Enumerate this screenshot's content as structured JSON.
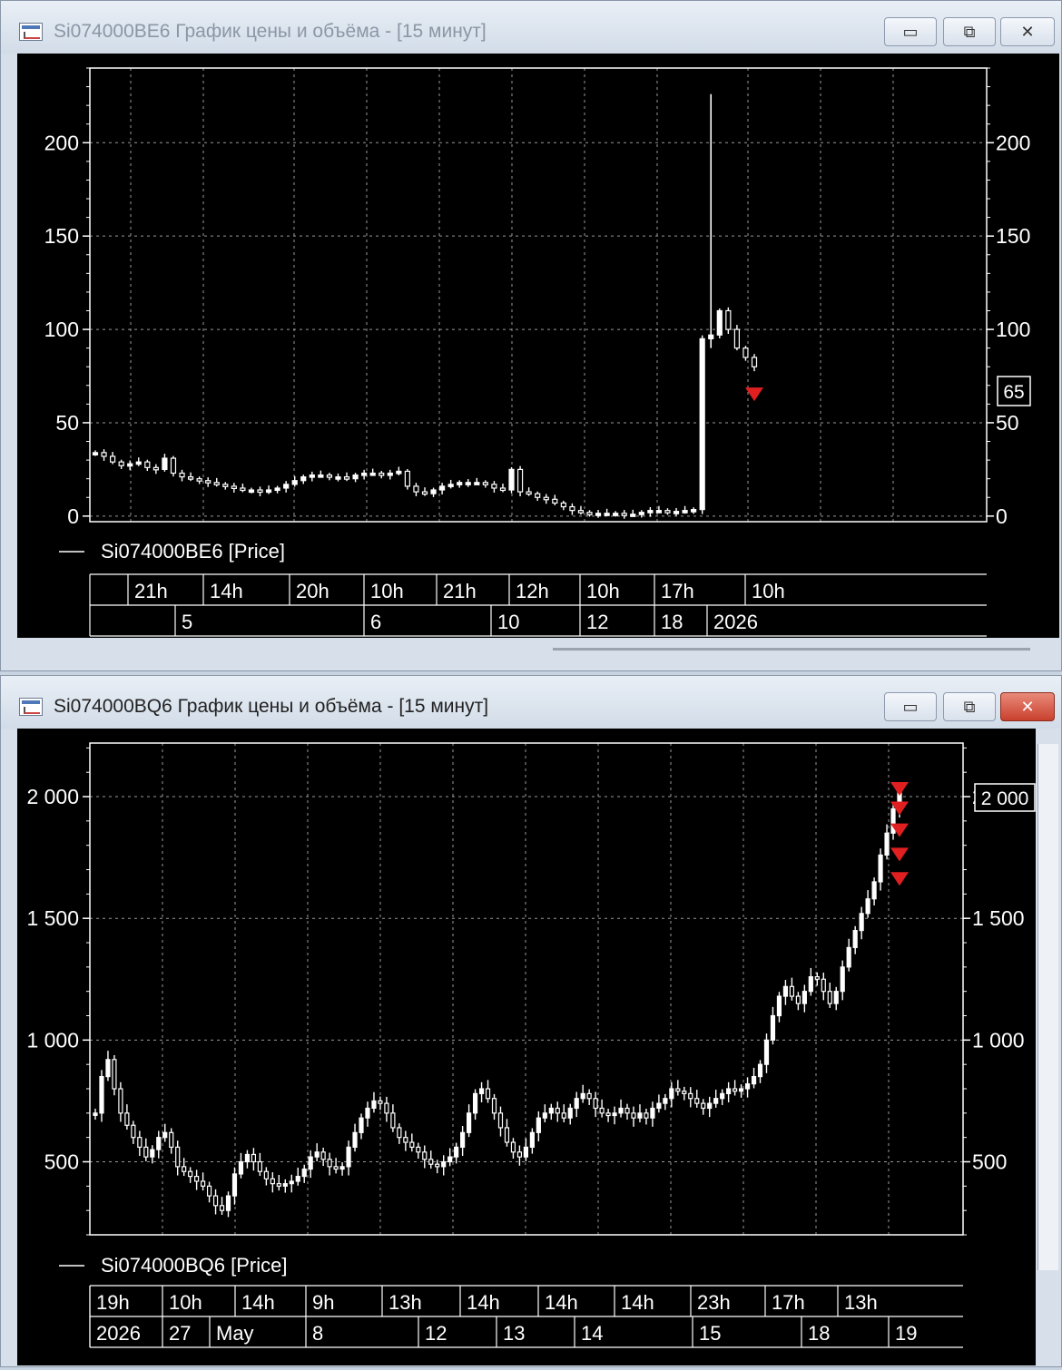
{
  "colors": {
    "background": "#000000",
    "grid": "#9a9a9a",
    "candle": "#ffffff",
    "marker": "#e02020",
    "window": "#d7e0ea",
    "close_active": "#c9402e"
  },
  "icons": {
    "app": "chart-window-icon",
    "minimize": "minimize-icon",
    "maximize": "maximize-icon",
    "close": "close-icon"
  },
  "windows": [
    {
      "title": "Si074000BE6 График цены и объёма - [15 минут]",
      "buttons": {
        "minimize": "▭",
        "maximize": "⧉",
        "close": "✕"
      },
      "legend": "Si074000BE6 [Price]",
      "price_badge": "65",
      "time_row": [
        "21h",
        "14h",
        "20h",
        "10h",
        "21h",
        "12h",
        "10h",
        "17h",
        "10h"
      ],
      "date_row": [
        "5",
        "6",
        "10",
        "12",
        "18",
        "2026"
      ]
    },
    {
      "title": "Si074000BQ6 График цены и объёма - [15 минут]",
      "buttons": {
        "minimize": "▭",
        "maximize": "⧉",
        "close": "✕"
      },
      "legend": "Si074000BQ6 [Price]",
      "price_badge": "2 000",
      "time_row": [
        "19h",
        "10h",
        "14h",
        "9h",
        "13h",
        "14h",
        "14h",
        "14h",
        "23h",
        "17h",
        "13h"
      ],
      "date_row": [
        "2026",
        "27",
        "May",
        "8",
        "12",
        "13",
        "14",
        "15",
        "18",
        "19"
      ]
    }
  ],
  "chart_data": [
    {
      "type": "candlestick",
      "title": "",
      "xlabel": "",
      "ylabel": "",
      "ylim": [
        -3,
        240
      ],
      "y_ticks": [
        0,
        50,
        100,
        150,
        200
      ],
      "y_tick_labels": [
        "0",
        "50",
        "100",
        "150",
        "200"
      ],
      "grid": true,
      "legend": "bottom-left",
      "series": [
        {
          "name": "Si074000BE6 [Price]",
          "values": [
            34,
            32,
            29,
            27,
            28,
            29,
            26,
            25,
            31,
            23,
            21,
            20,
            19,
            18,
            17,
            16,
            15,
            14,
            14,
            13,
            14,
            15,
            17,
            19,
            21,
            22,
            22,
            21,
            21,
            20,
            22,
            23,
            23,
            22,
            23,
            24,
            16,
            13,
            12,
            14,
            16,
            17,
            18,
            18,
            18,
            17,
            15,
            14,
            25,
            13,
            12,
            10,
            9,
            7,
            5,
            3,
            2,
            1.5,
            1.5,
            1.5,
            1.5,
            1,
            1,
            2,
            3,
            3,
            2.5,
            2.5,
            3,
            3.5,
            95,
            97,
            110,
            100,
            90,
            85,
            80
          ],
          "last_value": 65
        }
      ],
      "markers": [
        {
          "value": 65
        }
      ]
    },
    {
      "type": "candlestick",
      "title": "",
      "xlabel": "",
      "ylabel": "",
      "ylim": [
        200,
        2220
      ],
      "y_ticks": [
        500,
        1000,
        1500,
        2000
      ],
      "y_tick_labels": [
        "500",
        "1 000",
        "1 500",
        "2 000"
      ],
      "grid": true,
      "legend": "bottom-left",
      "series": [
        {
          "name": "Si074000BQ6 [Price]",
          "values": [
            700,
            850,
            920,
            800,
            700,
            650,
            600,
            560,
            520,
            550,
            600,
            620,
            560,
            480,
            460,
            440,
            420,
            400,
            360,
            320,
            300,
            360,
            450,
            500,
            530,
            500,
            460,
            430,
            410,
            400,
            410,
            420,
            440,
            470,
            520,
            540,
            510,
            480,
            470,
            480,
            560,
            620,
            680,
            720,
            750,
            740,
            700,
            640,
            600,
            580,
            560,
            540,
            510,
            490,
            480,
            500,
            520,
            560,
            620,
            700,
            780,
            800,
            760,
            700,
            640,
            580,
            540,
            520,
            560,
            620,
            680,
            700,
            720,
            700,
            680,
            720,
            760,
            780,
            760,
            720,
            700,
            690,
            700,
            720,
            700,
            680,
            700,
            680,
            720,
            740,
            760,
            800,
            790,
            780,
            760,
            740,
            720,
            740,
            760,
            780,
            800,
            790,
            800,
            820,
            850,
            900,
            1000,
            1100,
            1180,
            1220,
            1180,
            1150,
            1200,
            1260,
            1250,
            1200,
            1150,
            1200,
            1300,
            1380,
            1450,
            1520,
            1580,
            1650,
            1760,
            1850,
            1950,
            2020
          ],
          "last_value": 2000
        }
      ],
      "markers": [
        {
          "value": 1660
        },
        {
          "value": 1760
        },
        {
          "value": 1860
        },
        {
          "value": 1950
        },
        {
          "value": 2030
        }
      ]
    }
  ]
}
